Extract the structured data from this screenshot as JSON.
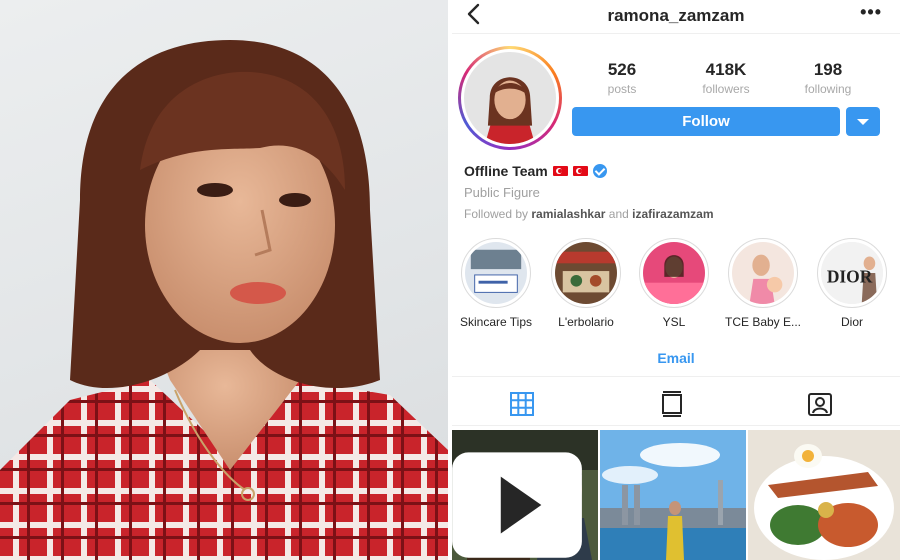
{
  "profile": {
    "username": "ramona_zamzam",
    "more_label": "•••",
    "stats": [
      {
        "value": "526",
        "label": "posts"
      },
      {
        "value": "418K",
        "label": "followers"
      },
      {
        "value": "198",
        "label": "following"
      }
    ],
    "follow_label": "Follow",
    "display_name": "Offline Team",
    "category": "Public Figure",
    "followed_by_prefix": "Followed by",
    "followed_by_user1": "ramialashkar",
    "followed_by_and": "and",
    "followed_by_user2": "izafirazamzam"
  },
  "highlights": [
    {
      "label": "Skincare Tips"
    },
    {
      "label": "L'erbolario"
    },
    {
      "label": "YSL"
    },
    {
      "label": "TCE Baby E..."
    },
    {
      "label": "Dior",
      "cover_text": "DIOR"
    }
  ],
  "contact": {
    "email_label": "Email"
  },
  "icons": {
    "back": "chevron-left-icon",
    "grid": "grid-icon",
    "feed": "feed-icon",
    "tagged": "tagged-icon",
    "video": "video-icon",
    "verified": "verified-badge-icon",
    "flag": "turkey-flag-icon"
  },
  "colors": {
    "accent": "#3897f0",
    "muted_text": "#a0a0a0",
    "text": "#262626"
  }
}
